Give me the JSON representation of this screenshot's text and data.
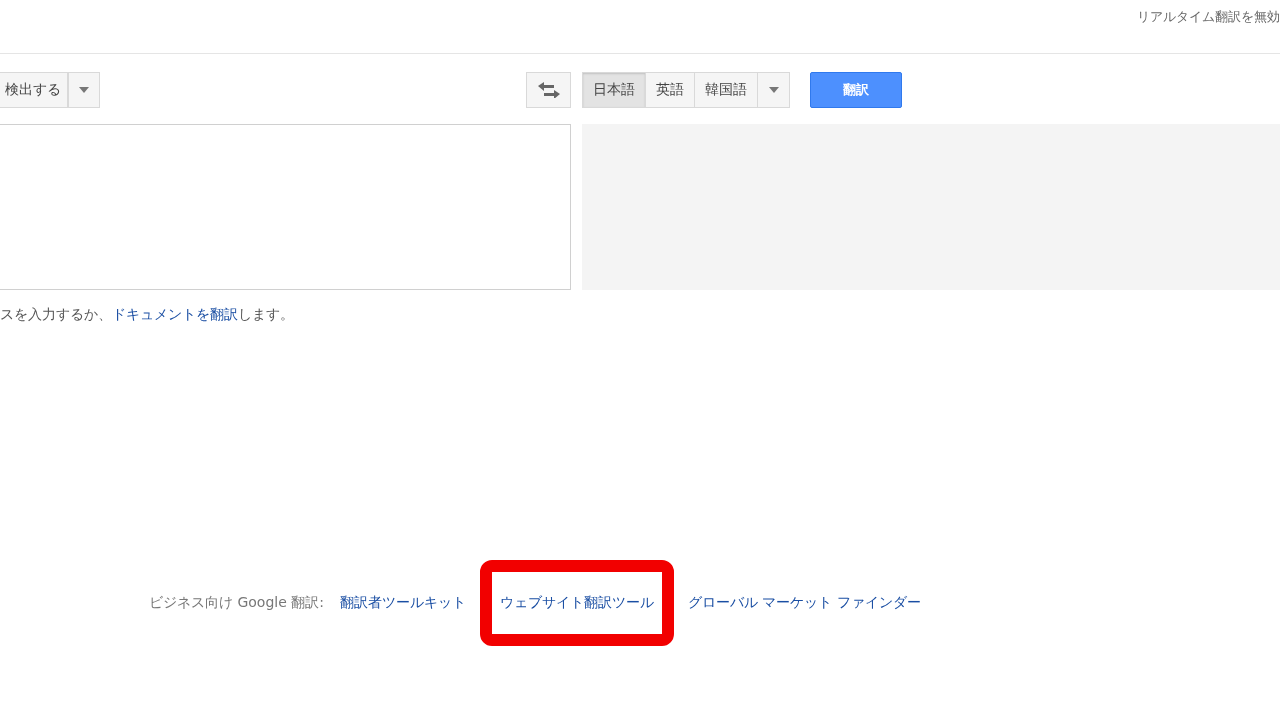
{
  "top_bar": {
    "realtime_link": "リアルタイム翻訳を無効"
  },
  "source_language": {
    "label": "検出する"
  },
  "target_languages": [
    {
      "label": "日本語",
      "selected": true
    },
    {
      "label": "英語",
      "selected": false
    },
    {
      "label": "韓国語",
      "selected": false
    }
  ],
  "translate_button": "翻訳",
  "hint": {
    "before": "スを入力するか、",
    "link": "ドキュメントを翻訳",
    "after": "します。"
  },
  "business_footer": {
    "label": "ビジネス向け Google 翻訳:",
    "links": [
      {
        "label": "翻訳者ツールキット",
        "highlighted": false
      },
      {
        "label": "ウェブサイト翻訳ツール",
        "highlighted": true
      },
      {
        "label": "グローバル マーケット ファインダー",
        "highlighted": false
      }
    ]
  }
}
